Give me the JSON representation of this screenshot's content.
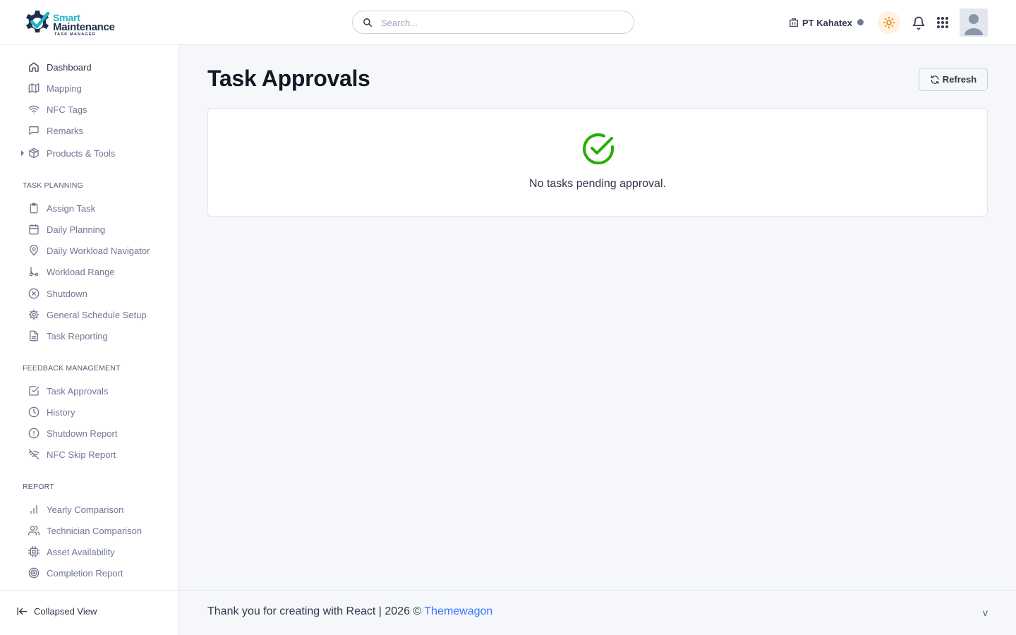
{
  "header": {
    "logo": {
      "line1": "Smart",
      "line2": "Maintenance",
      "line3": "TASK MANAGER"
    },
    "search_placeholder": "Search...",
    "company": "PT Kahatex",
    "icons": {
      "search": "search-icon",
      "company": "building-icon",
      "theme": "sun-icon",
      "notifications": "bell-icon",
      "apps": "grid-icon",
      "avatar": "user-avatar"
    }
  },
  "sidebar": {
    "top_items": [
      {
        "label": "Dashboard",
        "icon": "home-icon"
      },
      {
        "label": "Mapping",
        "icon": "map-icon"
      },
      {
        "label": "NFC Tags",
        "icon": "wifi-icon"
      },
      {
        "label": "Remarks",
        "icon": "message-icon"
      },
      {
        "label": "Products & Tools",
        "icon": "box-icon"
      }
    ],
    "sections": [
      {
        "title": "TASK PLANNING",
        "items": [
          {
            "label": "Assign Task",
            "icon": "clipboard-icon"
          },
          {
            "label": "Daily Planning",
            "icon": "calendar-icon"
          },
          {
            "label": "Daily Workload Navigator",
            "icon": "map-pin-icon"
          },
          {
            "label": "Workload Range",
            "icon": "git-branch-icon"
          },
          {
            "label": "Shutdown",
            "icon": "x-circle-icon"
          },
          {
            "label": "General Schedule Setup",
            "icon": "gear-icon"
          },
          {
            "label": "Task Reporting",
            "icon": "file-text-icon"
          }
        ]
      },
      {
        "title": "FEEDBACK MANAGEMENT",
        "items": [
          {
            "label": "Task Approvals",
            "icon": "check-square-icon"
          },
          {
            "label": "History",
            "icon": "clock-icon"
          },
          {
            "label": "Shutdown Report",
            "icon": "alert-circle-icon"
          },
          {
            "label": "NFC Skip Report",
            "icon": "wifi-off-icon"
          }
        ]
      },
      {
        "title": "REPORT",
        "items": [
          {
            "label": "Yearly Comparison",
            "icon": "bar-chart-icon"
          },
          {
            "label": "Technician Comparison",
            "icon": "users-icon"
          },
          {
            "label": "Asset Availability",
            "icon": "cpu-icon"
          },
          {
            "label": "Completion Report",
            "icon": "target-icon"
          }
        ]
      }
    ],
    "collapse_label": "Collapsed View"
  },
  "main": {
    "title": "Task Approvals",
    "refresh_label": "Refresh",
    "empty_message": "No tasks pending approval."
  },
  "footer": {
    "text": "Thank you for creating with React | 2026 ©",
    "link": "Themewagon",
    "version": "v"
  },
  "colors": {
    "accent": "#3874ff",
    "success": "#25b003",
    "brand_teal": "#1fb4c7",
    "brand_navy": "#1e2f4d"
  }
}
